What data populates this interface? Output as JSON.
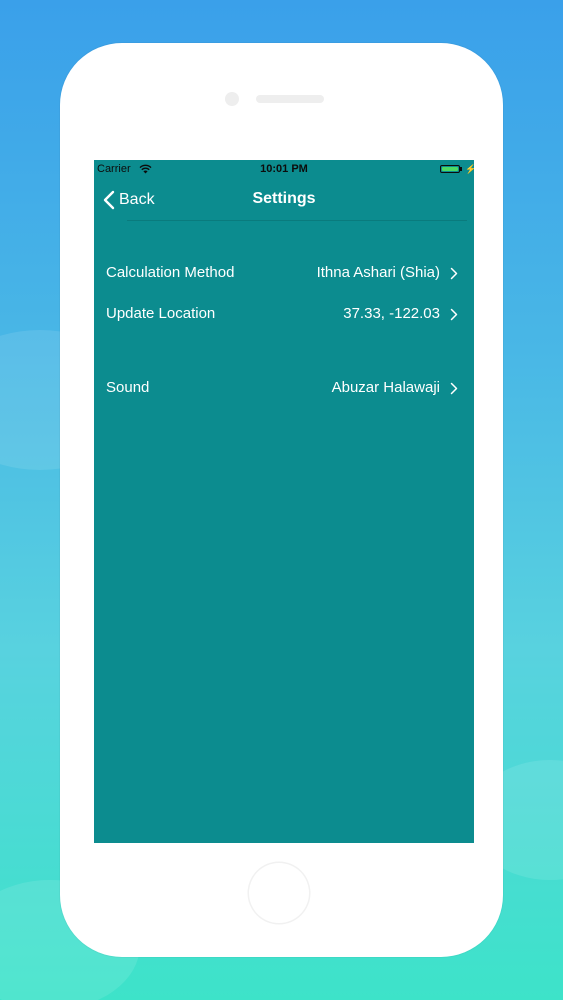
{
  "status_bar": {
    "carrier": "Carrier",
    "time": "10:01 PM",
    "battery_color": "#4cd964"
  },
  "nav": {
    "back_label": "Back",
    "title": "Settings"
  },
  "settings": {
    "calculation_method": {
      "label": "Calculation Method",
      "value": "Ithna Ashari (Shia)"
    },
    "update_location": {
      "label": "Update Location",
      "value": "37.33, -122.03"
    },
    "sound": {
      "label": "Sound",
      "value": "Abuzar Halawaji"
    }
  },
  "colors": {
    "screen_background": "#0c8c8f",
    "text": "#ffffff"
  },
  "icons": {
    "back": "chevron-left-icon",
    "row": "chevron-right-icon",
    "wifi": "wifi-icon",
    "battery": "battery-icon",
    "charging": "bolt-icon"
  }
}
